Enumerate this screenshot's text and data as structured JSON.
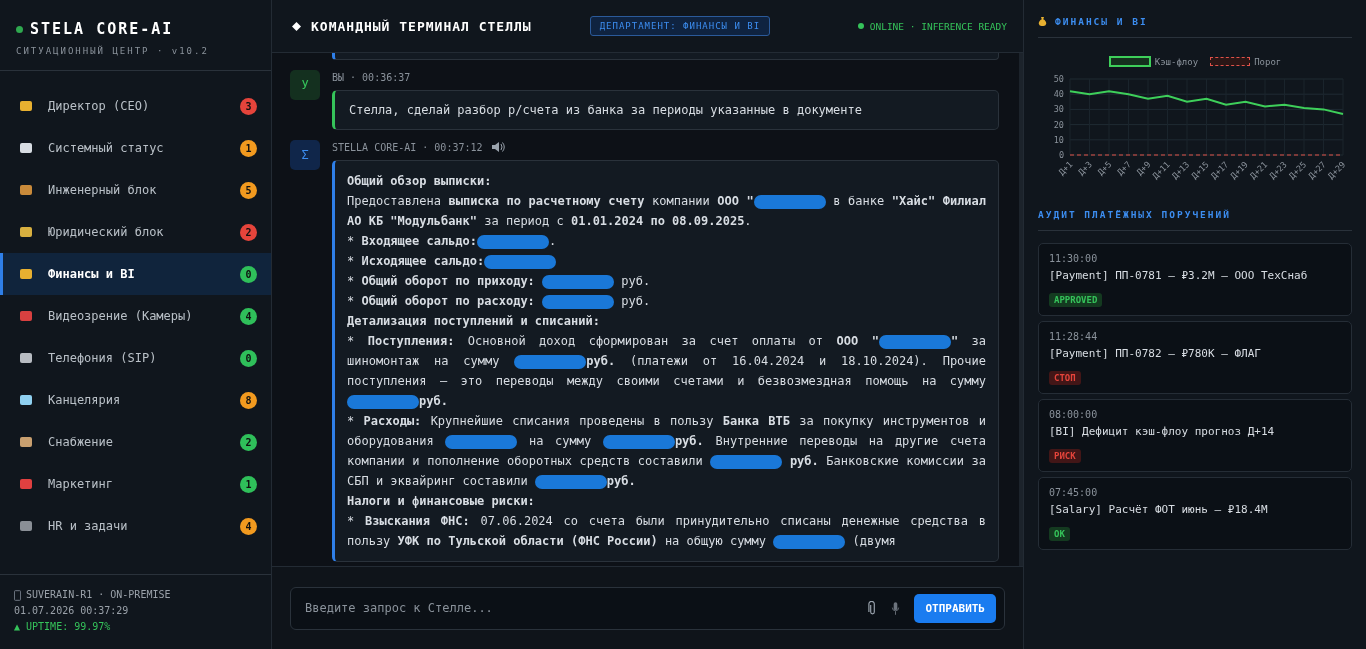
{
  "sidebar": {
    "brand": "STELA CORE-AI",
    "subtitle": "СИТУАЦИОННЫЙ ЦЕНТР · v10.2",
    "items": [
      {
        "label": "Директор (CEO)",
        "count": "3",
        "color": "#e5443b",
        "selected": false
      },
      {
        "label": "Системный статус",
        "count": "1",
        "color": "#f29a1f",
        "selected": false
      },
      {
        "label": "Инженерный блок",
        "count": "5",
        "color": "#f29a1f",
        "selected": false
      },
      {
        "label": "Юридический блок",
        "count": "2",
        "color": "#e5443b",
        "selected": false
      },
      {
        "label": "Финансы и BI",
        "count": "0",
        "color": "#2fbf5a",
        "selected": true
      },
      {
        "label": "Видеозрение (Камеры)",
        "count": "4",
        "color": "#2fbf5a",
        "selected": false
      },
      {
        "label": "Телефония (SIP)",
        "count": "0",
        "color": "#2fbf5a",
        "selected": false
      },
      {
        "label": "Канцелярия",
        "count": "8",
        "color": "#f29a1f",
        "selected": false
      },
      {
        "label": "Снабжение",
        "count": "2",
        "color": "#2fbf5a",
        "selected": false
      },
      {
        "label": "Маркетинг",
        "count": "1",
        "color": "#2fbf5a",
        "selected": false
      },
      {
        "label": "HR и задачи",
        "count": "4",
        "color": "#f29a1f",
        "selected": false
      }
    ],
    "footer": {
      "node": "SUVERAIN-R1 · ON-PREMISE",
      "datetime": "01.07.2026 00:37:29",
      "uptime": "▲ UPTIME: 99.97%"
    }
  },
  "header": {
    "title": "КОМАНДНЫЙ ТЕРМИНАЛ СТЕЛЛЫ",
    "department": "ДЕПАРТАМЕНТ: ФИНАНСЫ И BI",
    "status": "ONLINE · INFERENCE READY"
  },
  "messages": [
    {
      "kind": "user",
      "avatar": "У",
      "meta": "ВЫ · 00:36:37",
      "text": "Стелла, сделай разбор р/счета из банка за периоды указанные в документе"
    },
    {
      "kind": "assistant",
      "avatar": "Σ",
      "meta": "STELLA CORE-AI · 00:37:12",
      "paragraphs": [
        [
          {
            "kind": "text",
            "text": "**Общий обзор выписки:**"
          }
        ],
        [
          {
            "kind": "text",
            "text": "Предоставлена **выписка по расчетному счету** компании **ООО \"**"
          },
          {
            "kind": "redaction"
          },
          {
            "kind": "text",
            "text": " в банке **\"Хайс\" Филиал АО КБ \"Модульбанк\"** за период с **01.01.2024 по 08.09.2025**."
          }
        ],
        [
          {
            "kind": "text",
            "text": "* **Входящее сальдо:**"
          },
          {
            "kind": "redaction"
          },
          {
            "kind": "text",
            "text": "."
          }
        ],
        [
          {
            "kind": "text",
            "text": "* **Исходящее сальдо:**"
          },
          {
            "kind": "redaction"
          }
        ],
        [
          {
            "kind": "text",
            "text": "* **Общий оборот по приходу:** "
          },
          {
            "kind": "redaction"
          },
          {
            "kind": "text",
            "text": " руб."
          }
        ],
        [
          {
            "kind": "text",
            "text": "* **Общий оборот по расходу:** "
          },
          {
            "kind": "redaction"
          },
          {
            "kind": "text",
            "text": " руб."
          }
        ],
        [
          {
            "kind": "text",
            "text": "**Детализация поступлений и списаний:**"
          }
        ],
        [
          {
            "kind": "text",
            "text": "* **Поступления:** Основной доход сформирован за счет оплаты от **ООО \"**"
          },
          {
            "kind": "redaction"
          },
          {
            "kind": "text",
            "text": "**\"** за шиномонтаж на сумму "
          },
          {
            "kind": "redaction"
          },
          {
            "kind": "text",
            "text": "**руб.** (платежи от 16.04.2024 и 18.10.2024). Прочие поступления — это переводы между своими счетами и безвозмездная помощь на сумму "
          },
          {
            "kind": "redaction"
          },
          {
            "kind": "text",
            "text": "**руб.**"
          }
        ],
        [
          {
            "kind": "text",
            "text": "* **Расходы:** Крупнейшие списания проведены в пользу **Банка ВТБ** за покупку инструментов и оборудования "
          },
          {
            "kind": "redaction"
          },
          {
            "kind": "text",
            "text": " на сумму "
          },
          {
            "kind": "redaction"
          },
          {
            "kind": "text",
            "text": "**руб.** Внутренние переводы на другие счета компании и пополнение оборотных средств составили "
          },
          {
            "kind": "redaction"
          },
          {
            "kind": "text",
            "text": " **руб.** Банковские комиссии за СБП и эквайринг составили "
          },
          {
            "kind": "redaction"
          },
          {
            "kind": "text",
            "text": "**руб.**"
          }
        ],
        [
          {
            "kind": "text",
            "text": "**Налоги и финансовые риски:**"
          }
        ],
        [
          {
            "kind": "text",
            "text": "* **Взыскания ФНС:** 07.06.2024 со счета были принудительно списаны денежные средства в пользу **УФК по Тульской области (ФНС России)** на общую сумму "
          },
          {
            "kind": "redaction"
          },
          {
            "kind": "text",
            "text": " (двумя"
          }
        ]
      ]
    }
  ],
  "composer": {
    "placeholder": "Введите запрос к Стелле...",
    "send": "ОТПРАВИТЬ"
  },
  "panel": {
    "title": "ФИНАНСЫ И BI",
    "chart_data": {
      "type": "line",
      "grid": true,
      "categories": [
        "Д+1",
        "Д+3",
        "Д+5",
        "Д+7",
        "Д+9",
        "Д+11",
        "Д+13",
        "Д+15",
        "Д+17",
        "Д+19",
        "Д+21",
        "Д+23",
        "Д+25",
        "Д+27",
        "Д+29"
      ],
      "series": [
        {
          "name": "Кэш-флоу",
          "color": "#3ecf5a",
          "line_style": "solid",
          "values": [
            42,
            40,
            42,
            40,
            37,
            39,
            35,
            37,
            33,
            35,
            32,
            33,
            31,
            30,
            27
          ]
        },
        {
          "name": "Порог",
          "color": "#e0524a",
          "line_style": "dashed",
          "values": [
            0,
            0,
            0,
            0,
            0,
            0,
            0,
            0,
            0,
            0,
            0,
            0,
            0,
            0,
            0
          ]
        }
      ],
      "ylim": [
        0,
        50
      ],
      "yticks": [
        0,
        10,
        20,
        30,
        40,
        50
      ]
    },
    "audit_title": "АУДИТ ПЛАТЁЖНЫХ ПОРУЧЕНИЙ",
    "audit": [
      {
        "time": "11:30:00",
        "text": "[Payment] ПП-0781 — ₽3.2M — ООО ТехСнаб",
        "tag": "APPROVED",
        "kind": "good"
      },
      {
        "time": "11:28:44",
        "text": "[Payment] ПП-0782 — ₽780K — ФЛАГ",
        "tag": "СТОП",
        "kind": "bad"
      },
      {
        "time": "08:00:00",
        "text": "[BI] Дефицит кэш-флоу прогноз Д+14",
        "tag": "РИСК",
        "kind": "bad"
      },
      {
        "time": "07:45:00",
        "text": "[Salary] Расчёт ФОТ июнь — ₽18.4M",
        "tag": "OK",
        "kind": "good"
      }
    ]
  }
}
